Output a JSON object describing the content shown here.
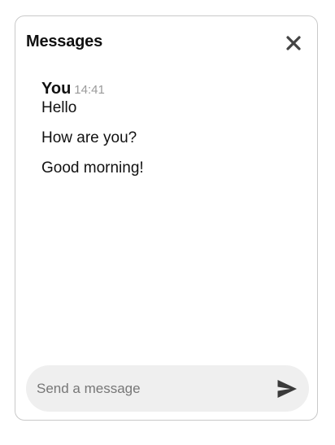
{
  "chat": {
    "title": "Messages",
    "close_icon": "close-icon",
    "messages": [
      {
        "sender": "You",
        "time": "14:41",
        "lines": [
          "Hello",
          "How are you?",
          "Good morning!"
        ]
      }
    ],
    "composer": {
      "placeholder": "Send a message",
      "value": "",
      "send_icon": "send-icon"
    }
  },
  "colors": {
    "border": "#c9c9c9",
    "composer_bg": "#efefef",
    "timestamp": "#9a9a9a",
    "icon": "#444444"
  }
}
